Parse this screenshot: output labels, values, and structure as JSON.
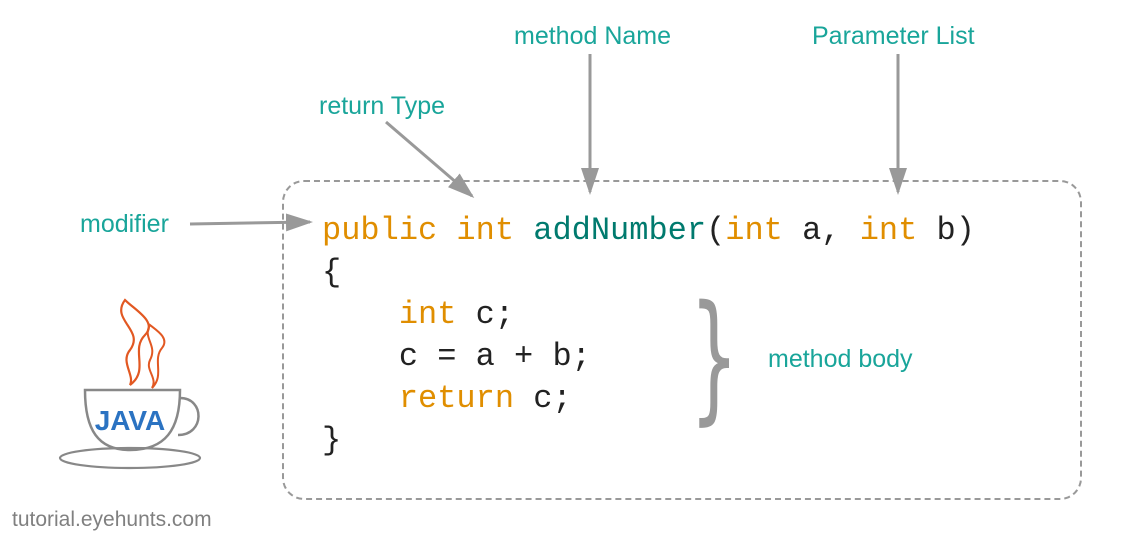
{
  "labels": {
    "modifier": "modifier",
    "returnType": "return Type",
    "methodName": "method Name",
    "parameterList": "Parameter List",
    "methodBody": "method body"
  },
  "code": {
    "modifier": "public",
    "returnType": "int",
    "methodName": "addNumber",
    "openParen": "(",
    "param1Type": "int",
    "param1Name": "a",
    "comma": ",",
    "param2Type": "int",
    "param2Name": "b",
    "closeParen": ")",
    "openBrace": "{",
    "line1Type": "int",
    "line1Rest": " c;",
    "line2": "c = a + b;",
    "line3Kw": "return",
    "line3Rest": " c;",
    "closeBrace": "}"
  },
  "logo": {
    "text": "JAVA"
  },
  "footer": "tutorial.eyehunts.com"
}
